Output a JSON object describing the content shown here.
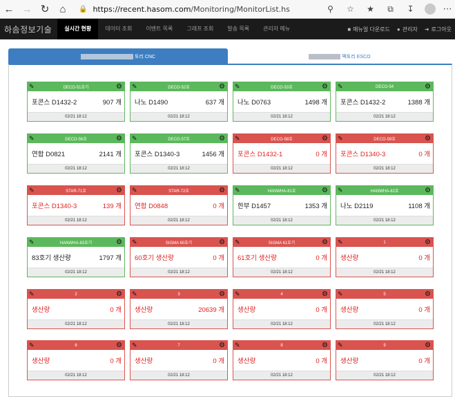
{
  "browser": {
    "url_host": "https://recent.hasom.com",
    "url_path": "/Monitoring/MonitorList.hs"
  },
  "app": {
    "brand": "하솜정보기술",
    "menu": [
      "실시간 현황",
      "데이터 조회",
      "이벤트 목록",
      "그래프 조회",
      "발송 목록",
      "관리자 메뉴"
    ],
    "right_menu": [
      "매뉴얼 다운로드",
      "관리자",
      "로그아웃"
    ]
  },
  "tabs": [
    {
      "label": "토리 CNC"
    },
    {
      "label": "팩토리 ESCO"
    }
  ],
  "colors": {
    "normal": "#5cb85c",
    "alert": "#d9534f",
    "tab": "#3d7ec0"
  },
  "cards": [
    {
      "title": "DECO-51호기",
      "product": "포콘스 D1432-2",
      "count": "907 개",
      "time": "02/21 18:12",
      "status": "green"
    },
    {
      "title": "DECO-52호",
      "product": "나노 D1490",
      "count": "637 개",
      "time": "02/21 18:12",
      "status": "green"
    },
    {
      "title": "DECO-53호",
      "product": "나노 D0763",
      "count": "1498 개",
      "time": "02/21 18:12",
      "status": "green"
    },
    {
      "title": "DECO-54",
      "product": "포콘스 D1432-2",
      "count": "1388 개",
      "time": "02/21 18:12",
      "status": "green"
    },
    {
      "title": "DECO-56호",
      "product": "연합 D0821",
      "count": "2141 개",
      "time": "02/21 18:12",
      "status": "green"
    },
    {
      "title": "DECO-57호",
      "product": "포콘스 D1340-3",
      "count": "1456 개",
      "time": "02/21 18:12",
      "status": "green"
    },
    {
      "title": "DECO-58호",
      "product": "포콘스 D1432-1",
      "count": "0 개",
      "time": "02/21 18:12",
      "status": "red"
    },
    {
      "title": "DECO-59호",
      "product": "포콘스 D1340-3",
      "count": "0 개",
      "time": "02/21 18:12",
      "status": "red"
    },
    {
      "title": "STAR-71호",
      "product": "포콘스 D1340-3",
      "count": "139 개",
      "time": "02/21 18:12",
      "status": "red"
    },
    {
      "title": "STAR-72호",
      "product": "연합 D0848",
      "count": "0 개",
      "time": "02/21 18:12",
      "status": "red"
    },
    {
      "title": "HANWHA-81호",
      "product": "한부 D1457",
      "count": "1353 개",
      "time": "02/21 18:12",
      "status": "green"
    },
    {
      "title": "HANWHA-82호",
      "product": "나노 D2119",
      "count": "1108 개",
      "time": "02/21 18:12",
      "status": "green"
    },
    {
      "title": "HANWHA-83호기",
      "product": "83호기 생산량",
      "count": "1797 개",
      "time": "02/21 18:12",
      "status": "green"
    },
    {
      "title": "SIGMA 60호기",
      "product": "60호기 생산량",
      "count": "0 개",
      "time": "02/21 18:12",
      "status": "red"
    },
    {
      "title": "SIGMA 61호기",
      "product": "61호기 생산량",
      "count": "0 개",
      "time": "02/21 18:12",
      "status": "red"
    },
    {
      "title": "1",
      "product": "생산량",
      "count": "0 개",
      "time": "02/21 18:12",
      "status": "red"
    },
    {
      "title": "2",
      "product": "생산량",
      "count": "0 개",
      "time": "02/21 18:12",
      "status": "red"
    },
    {
      "title": "3",
      "product": "생산량",
      "count": "20639 개",
      "time": "02/21 18:12",
      "status": "red"
    },
    {
      "title": "4",
      "product": "생산량",
      "count": "0 개",
      "time": "02/21 18:12",
      "status": "red"
    },
    {
      "title": "5",
      "product": "생산량",
      "count": "0 개",
      "time": "02/21 18:12",
      "status": "red"
    },
    {
      "title": "6",
      "product": "생산량",
      "count": "0 개",
      "time": "02/21 18:12",
      "status": "red"
    },
    {
      "title": "7",
      "product": "생산량",
      "count": "0 개",
      "time": "02/21 18:12",
      "status": "red"
    },
    {
      "title": "8",
      "product": "생산량",
      "count": "0 개",
      "time": "02/21 18:12",
      "status": "red"
    },
    {
      "title": "9",
      "product": "생산량",
      "count": "0 개",
      "time": "02/21 18:12",
      "status": "red"
    }
  ]
}
